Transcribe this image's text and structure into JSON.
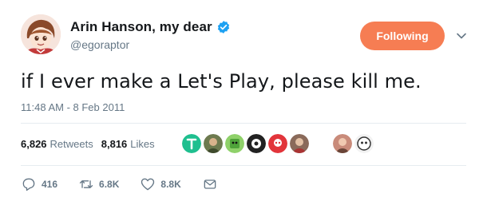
{
  "author": {
    "name": "Arin Hanson, my dear",
    "handle": "@egoraptor",
    "verified": true
  },
  "follow_button": {
    "label": "Following",
    "color": "#f67d53"
  },
  "tweet": {
    "text": "if I ever make a Let's Play, please kill me.",
    "timestamp": "11:48 AM - 8 Feb 2011"
  },
  "stats": {
    "retweets": {
      "value": "6,826",
      "label": "Retweets"
    },
    "likes": {
      "value": "8,816",
      "label": "Likes"
    }
  },
  "actions": {
    "reply": {
      "icon": "reply-icon",
      "count": "416"
    },
    "retweet": {
      "icon": "retweet-icon",
      "count": "6.8K"
    },
    "like": {
      "icon": "heart-icon",
      "count": "8.8K"
    },
    "message": {
      "icon": "direct-message-icon"
    }
  },
  "colors": {
    "text": "#14171a",
    "secondary": "#657786",
    "verified": "#1da1f2",
    "divider": "#e6ecf0"
  }
}
